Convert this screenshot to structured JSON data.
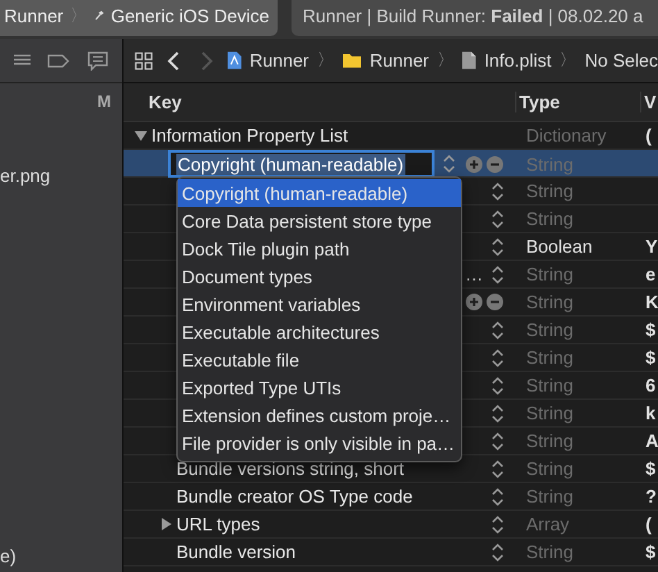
{
  "toolbar": {
    "scheme": {
      "project": "Runner",
      "separator": "〉",
      "device": "Generic iOS Device"
    },
    "status": {
      "text": "Runner | Build Runner: **Failed** | 08.02.20 a"
    }
  },
  "sidebar": {
    "column_label": "M",
    "items": [
      {
        "label": "er.png"
      },
      {
        "label": "e)"
      }
    ]
  },
  "jump_bar": {
    "back_disabled": false,
    "forward_disabled": true,
    "path": [
      {
        "kind": "project",
        "label": "Runner"
      },
      {
        "kind": "folder",
        "label": "Runner"
      },
      {
        "kind": "file",
        "label": "Info.plist"
      },
      {
        "kind": "text",
        "label": "No Selec"
      }
    ],
    "separator": "〉"
  },
  "table": {
    "columns": [
      "Key",
      "Type",
      "V"
    ],
    "rows": [
      {
        "key": "Information Property List",
        "expanded": true,
        "type": "Dictionary",
        "type_dimmed": true,
        "value": "(",
        "selected": false,
        "stepper": false,
        "add_remove": false
      },
      {
        "key": "Copyright (human-readable)",
        "editing": true,
        "type": "String",
        "type_dimmed": true,
        "selected": true,
        "stepper": true,
        "add_remove": true
      },
      {
        "type": "String",
        "type_dimmed": true,
        "selected": false,
        "stepper": true,
        "add_remove": false
      },
      {
        "type": "String",
        "type_dimmed": true,
        "selected": false,
        "stepper": true,
        "add_remove": false
      },
      {
        "type": "Boolean",
        "type_dimmed": false,
        "value": "Y",
        "selected": false,
        "stepper": true,
        "add_remove": false
      },
      {
        "key_tail": "…",
        "type": "String",
        "type_dimmed": true,
        "value": "e",
        "selected": false,
        "stepper": true,
        "add_remove": false
      },
      {
        "type": "String",
        "type_dimmed": true,
        "value": "K",
        "selected": false,
        "stepper": false,
        "add_remove": true
      },
      {
        "type": "String",
        "type_dimmed": true,
        "value": "$",
        "selected": false,
        "stepper": true,
        "add_remove": false
      },
      {
        "type": "String",
        "type_dimmed": true,
        "value": "$",
        "selected": false,
        "stepper": true,
        "add_remove": false
      },
      {
        "type": "String",
        "type_dimmed": true,
        "value": "6",
        "selected": false,
        "stepper": true,
        "add_remove": false
      },
      {
        "type": "String",
        "type_dimmed": true,
        "value": "k",
        "selected": false,
        "stepper": true,
        "add_remove": false
      },
      {
        "type": "String",
        "type_dimmed": true,
        "value": "A",
        "selected": false,
        "stepper": true,
        "add_remove": false
      },
      {
        "key": "Bundle versions string, short",
        "type": "String",
        "type_dimmed": true,
        "value": "$",
        "selected": false,
        "stepper": true,
        "add_remove": false
      },
      {
        "key": "Bundle creator OS Type code",
        "type": "String",
        "type_dimmed": true,
        "value": "?",
        "selected": false,
        "stepper": true,
        "add_remove": false
      },
      {
        "key": "URL types",
        "expanded": false,
        "type": "Array",
        "type_dimmed": true,
        "value": "(",
        "selected": false,
        "stepper": true,
        "add_remove": false
      },
      {
        "key": "Bundle version",
        "type": "String",
        "type_dimmed": true,
        "value": "$",
        "selected": false,
        "stepper": true,
        "add_remove": false
      }
    ]
  },
  "key_menu": {
    "items": [
      {
        "label": "Copyright (human-readable)",
        "selected": true
      },
      {
        "label": "Core Data persistent store type",
        "selected": false
      },
      {
        "label": "Dock Tile plugin path",
        "selected": false
      },
      {
        "label": "Document types",
        "selected": false
      },
      {
        "label": "Environment variables",
        "selected": false
      },
      {
        "label": "Executable architectures",
        "selected": false
      },
      {
        "label": "Executable file",
        "selected": false
      },
      {
        "label": "Exported Type UTIs",
        "selected": false
      },
      {
        "label": "Extension defines custom proje…",
        "selected": false
      },
      {
        "label": "File provider is only visible in pa…",
        "selected": false
      }
    ]
  }
}
